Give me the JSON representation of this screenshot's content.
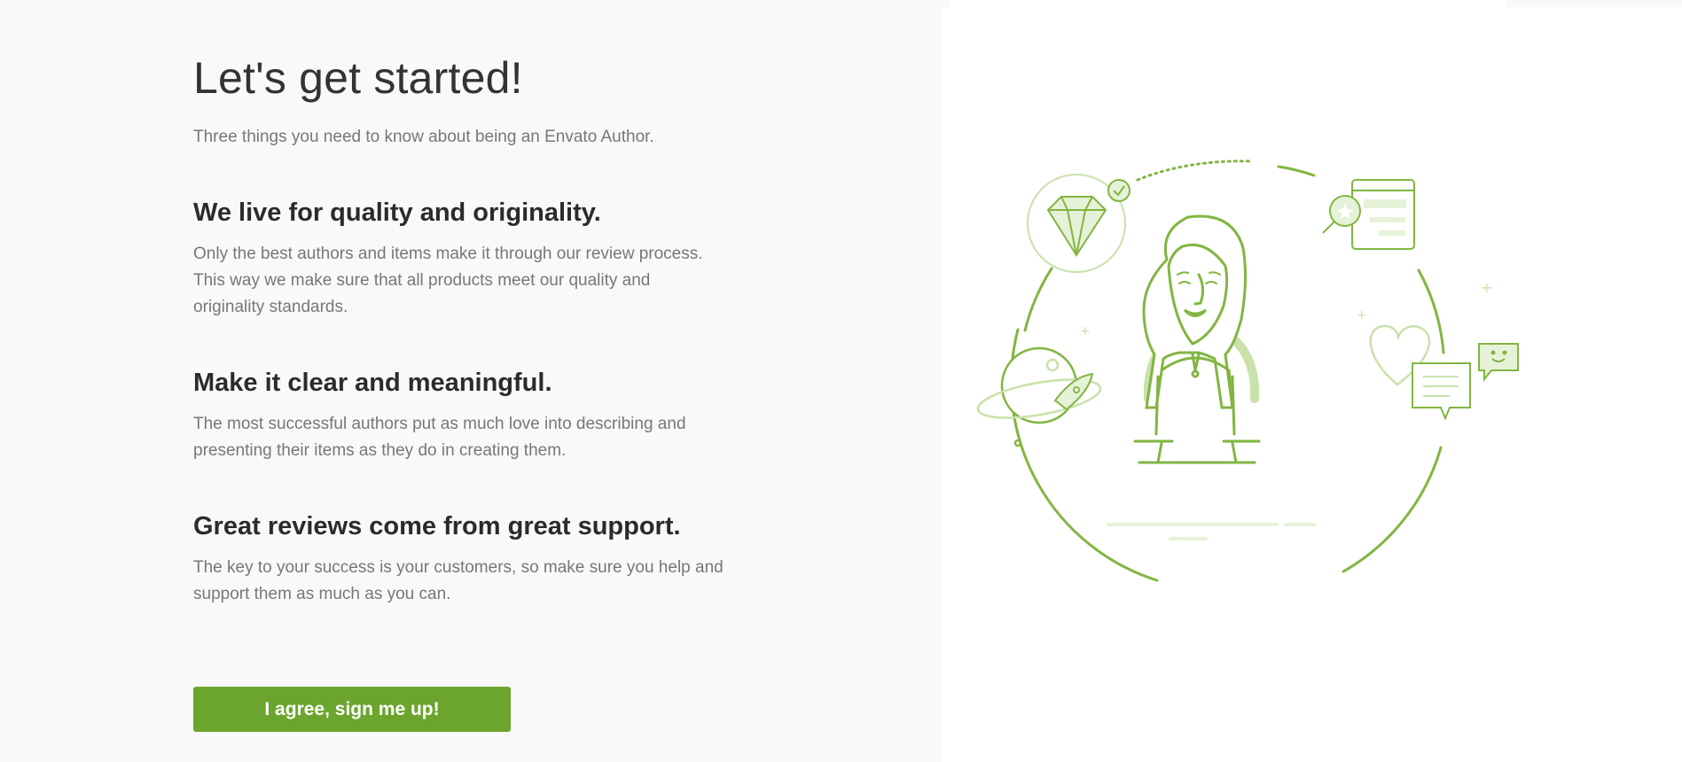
{
  "header": {
    "title": "Let's get started!",
    "subtitle": "Three things you need to know about being an Envato Author."
  },
  "sections": [
    {
      "heading": "We live for quality and originality.",
      "lines": [
        "Only the best authors and items make it through our review process.",
        "This way we make sure that all products meet our quality and",
        "originality standards."
      ]
    },
    {
      "heading": "Make it clear and meaningful.",
      "lines": [
        "The most successful authors put as much love into describing and",
        "presenting their items as they do in creating them."
      ]
    },
    {
      "heading": "Great reviews come from great support.",
      "lines": [
        "The key to your success is your customers, so make sure you help and",
        "support them as much as you can."
      ]
    }
  ],
  "cta": {
    "label": "I agree, sign me up!"
  },
  "colors": {
    "accent": "#6ca52e",
    "illustration_line": "#82b541",
    "illustration_light": "#c9e2aa"
  },
  "icons": [
    "diamond-icon",
    "checkmark-icon",
    "magnifier-icon",
    "planet-icon",
    "rocket-icon",
    "heart-icon",
    "chat-bubble-icon",
    "smiley-chat-icon",
    "author-avatar-illustration"
  ]
}
